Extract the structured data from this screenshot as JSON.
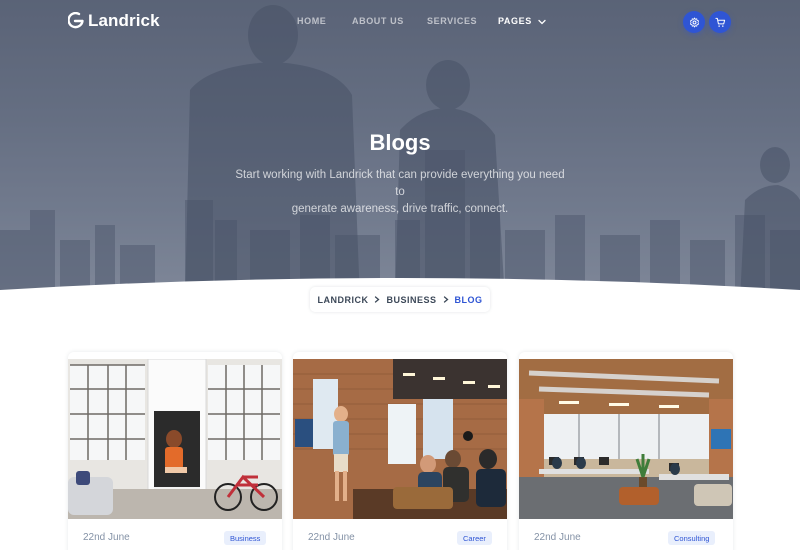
{
  "brand": {
    "name": "Landrick"
  },
  "nav": {
    "items": [
      {
        "label": "HOME"
      },
      {
        "label": "ABOUT US"
      },
      {
        "label": "SERVICES"
      },
      {
        "label": "PAGES"
      }
    ]
  },
  "icons": {
    "settings": "gear-icon",
    "cart": "cart-icon",
    "pages_dropdown": "chevron-down-icon",
    "breadcrumb_separator": "chevron-right-icon"
  },
  "colors": {
    "primary": "#2f55d4",
    "tag_bg": "#e9effc",
    "text_dark": "#3c4858",
    "text_muted": "#8492a6"
  },
  "hero": {
    "title": "Blogs",
    "subtitle_line1": "Start working with Landrick that can provide everything you need to",
    "subtitle_line2": "generate awareness, drive traffic, connect."
  },
  "breadcrumb": {
    "items": [
      {
        "label": "LANDRICK"
      },
      {
        "label": "BUSINESS"
      },
      {
        "label": "BLOG"
      }
    ]
  },
  "posts": [
    {
      "date": "22nd June",
      "tag": "Business"
    },
    {
      "date": "22nd June",
      "tag": "Career"
    },
    {
      "date": "22nd June",
      "tag": "Consulting"
    }
  ]
}
